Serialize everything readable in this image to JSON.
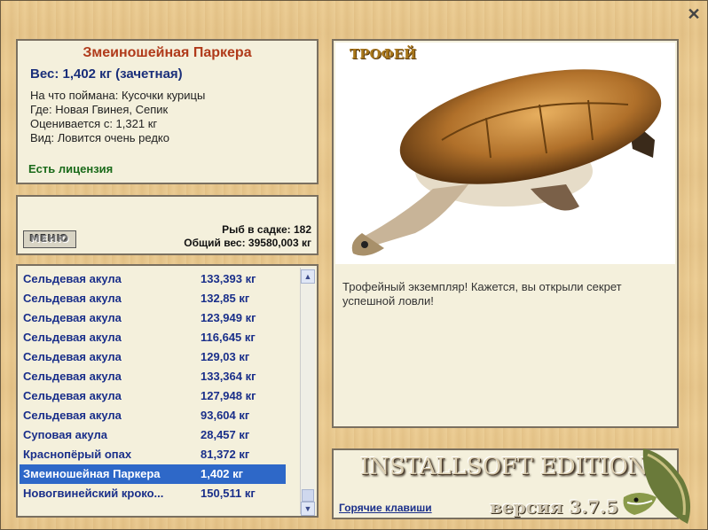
{
  "fish": {
    "name": "Змеиношейная Паркера",
    "weight": "Вес: 1,402 кг (зачетная)",
    "bait": "На что поймана: Кусочки курицы",
    "place": "Где: Новая Гвинея, Сепик",
    "min_weight": "Оценивается с: 1,321 кг",
    "rarity": "Вид: Ловится очень редко",
    "license": "Есть лицензия"
  },
  "keepnet": {
    "menu_label": "МЕНЮ",
    "count": "Рыб в садке: 182",
    "total": "Общий вес: 39580,003 кг"
  },
  "catch_list": [
    {
      "name": "Сельдевая акула",
      "weight": "133,393 кг"
    },
    {
      "name": "Сельдевая акула",
      "weight": "132,85 кг"
    },
    {
      "name": "Сельдевая акула",
      "weight": "123,949 кг"
    },
    {
      "name": "Сельдевая акула",
      "weight": "116,645 кг"
    },
    {
      "name": "Сельдевая акула",
      "weight": "129,03 кг"
    },
    {
      "name": "Сельдевая акула",
      "weight": "133,364 кг"
    },
    {
      "name": "Сельдевая акула",
      "weight": "127,948 кг"
    },
    {
      "name": "Сельдевая акула",
      "weight": "93,604 кг"
    },
    {
      "name": "Суповая акула",
      "weight": "28,457 кг"
    },
    {
      "name": "Краснопёрый опах",
      "weight": "81,372 кг"
    },
    {
      "name": "Змеиношейная Паркера",
      "weight": "1,402 кг",
      "selected": true
    },
    {
      "name": "Новогвинейский кроко...",
      "weight": "150,511 кг"
    }
  ],
  "trophy": {
    "label": "ТРОФЕЙ",
    "description": "Трофейный экземпляр! Кажется, вы открыли секрет успешной ловли!"
  },
  "brand": {
    "logo": "INSTALLSOFT EDITION",
    "hotkeys": "Горячие клавиши",
    "version": "версия 3.7.5"
  },
  "icons": [
    "close-icon",
    "turtle-image",
    "pike-icon",
    "scroll-up-icon",
    "scroll-down-icon"
  ],
  "colors": {
    "title": "#b03a1a",
    "accent": "#1a2f8a",
    "selection": "#2e68c8",
    "license": "#1a6a1a"
  }
}
